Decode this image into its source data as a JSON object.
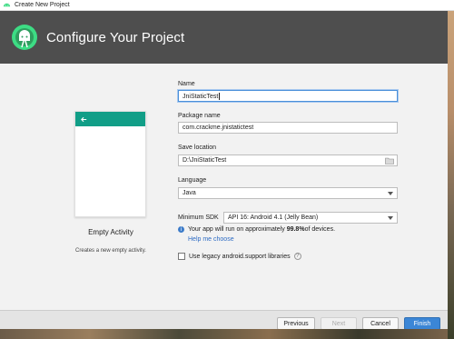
{
  "window": {
    "title": "Create New Project"
  },
  "header": {
    "title": "Configure Your Project"
  },
  "template": {
    "name": "Empty Activity",
    "description": "Creates a new empty activity."
  },
  "form": {
    "name_label": "Name",
    "name_value": "JniStaticTest",
    "package_label": "Package name",
    "package_value": "com.crackme.jnistatictest",
    "location_label": "Save location",
    "location_value": "D:\\JniStaticTest",
    "language_label": "Language",
    "language_value": "Java",
    "sdk_label": "Minimum SDK",
    "sdk_value": "API 16: Android 4.1 (Jelly Bean)",
    "info_prefix": "Your app will run on approximately ",
    "info_percent": "99.8%",
    "info_suffix": " of devices.",
    "help_link": "Help me choose",
    "legacy_label": "Use legacy android.support libraries",
    "legacy_checked": false
  },
  "footer": {
    "previous": "Previous",
    "next": "Next",
    "cancel": "Cancel",
    "finish": "Finish"
  },
  "colors": {
    "header_bg": "#4e4e4e",
    "card_appbar": "#119e87",
    "primary_button": "#3b86d6",
    "link": "#2e6cc4"
  },
  "icons": {
    "app": "android-studio-icon",
    "logo": "android-studio-logo",
    "back": "back-arrow-icon",
    "folder": "folder-icon",
    "info": "info-icon",
    "help": "question-icon"
  }
}
